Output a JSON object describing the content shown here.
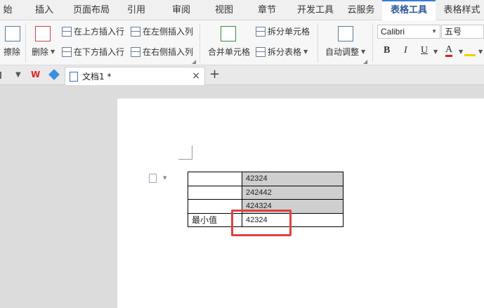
{
  "ribbon_tabs": [
    "始",
    "插入",
    "页面布局",
    "引用",
    "审阅",
    "视图",
    "章节",
    "开发工具",
    "云服务",
    "表格工具",
    "表格样式"
  ],
  "active_tab": "表格工具",
  "toolbar": {
    "erase": "擦除",
    "delete": "删除",
    "insert_above": "在上方插入行",
    "insert_below": "在下方插入行",
    "insert_left": "在左侧插入列",
    "insert_right": "在右侧插入列",
    "merge_cells": "合并单元格",
    "split_cells": "拆分单元格",
    "split_table": "拆分表格",
    "auto_fit": "自动调整",
    "font_name": "Calibri",
    "font_size": "五号",
    "bold": "B",
    "italic": "I",
    "underline": "U",
    "font_color": "A"
  },
  "doc_tab": {
    "title": "文档1 *",
    "close": "×",
    "add": "+"
  },
  "table": {
    "rows": [
      [
        "",
        "42324"
      ],
      [
        "",
        "242442"
      ],
      [
        "",
        "424324"
      ],
      [
        "最小值",
        "42324"
      ]
    ]
  },
  "colors": {
    "accent": "#3d7ad6",
    "highlight": "#e04040",
    "shade": "#cfcfcf"
  }
}
